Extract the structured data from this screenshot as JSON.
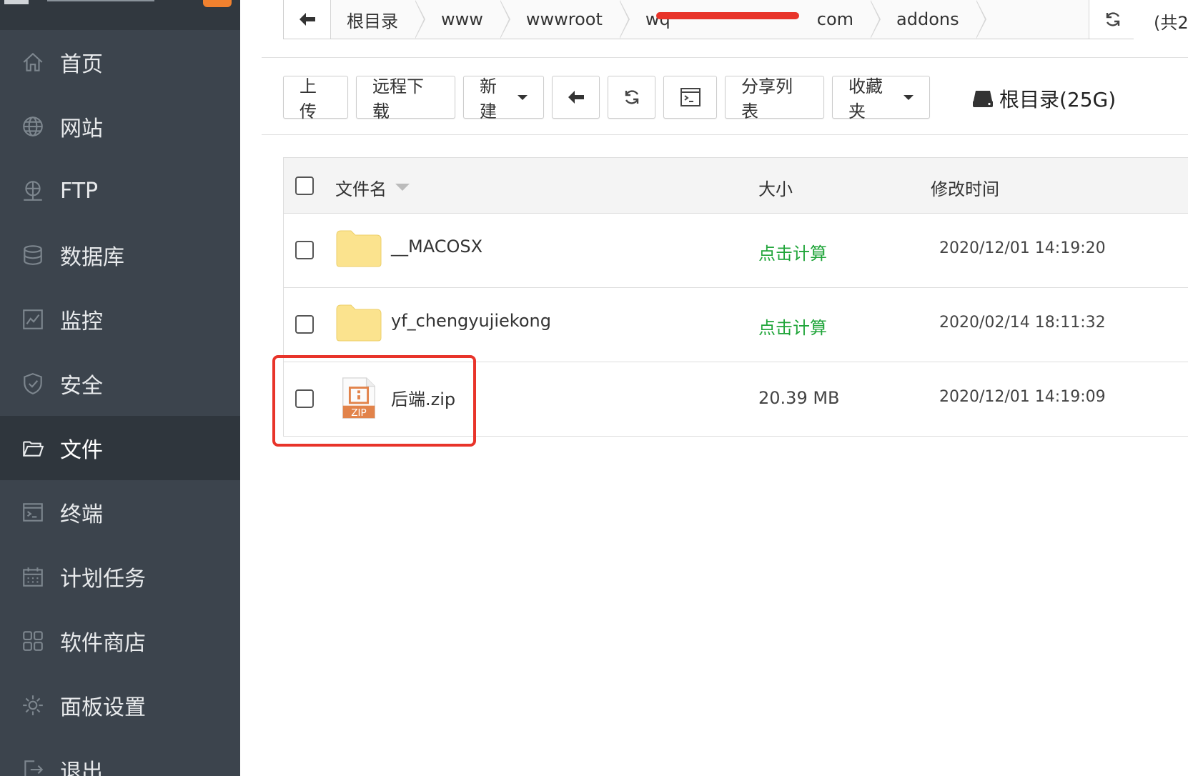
{
  "sidebar": {
    "items": [
      {
        "label": "首页",
        "icon": "home-icon"
      },
      {
        "label": "网站",
        "icon": "globe-icon"
      },
      {
        "label": "FTP",
        "icon": "ftp-icon"
      },
      {
        "label": "数据库",
        "icon": "database-icon"
      },
      {
        "label": "监控",
        "icon": "monitor-icon"
      },
      {
        "label": "安全",
        "icon": "shield-icon"
      },
      {
        "label": "文件",
        "icon": "folder-open-icon",
        "active": true
      },
      {
        "label": "终端",
        "icon": "terminal-icon"
      },
      {
        "label": "计划任务",
        "icon": "calendar-icon"
      },
      {
        "label": "软件商店",
        "icon": "apps-grid-icon"
      },
      {
        "label": "面板设置",
        "icon": "gear-icon"
      },
      {
        "label": "退出",
        "icon": "logout-icon"
      }
    ]
  },
  "breadcrumb": {
    "items": [
      "根目录",
      "www",
      "wwwroot",
      "wq",
      "com",
      "addons"
    ],
    "count_text": "(共2"
  },
  "toolbar": {
    "upload": "上传",
    "remote_download": "远程下载",
    "new": "新建",
    "share_list": "分享列表",
    "favorites": "收藏夹",
    "disk_label": "根目录(25G)"
  },
  "table": {
    "headers": {
      "name": "文件名",
      "size": "大小",
      "modified": "修改时间"
    },
    "rows": [
      {
        "name": "__MACOSX",
        "type": "folder",
        "size": "点击计算",
        "modified": "2020/12/01 14:19:20"
      },
      {
        "name": "yf_chengyujiekong",
        "type": "folder",
        "size": "点击计算",
        "modified": "2020/02/14 18:11:32"
      },
      {
        "name": "后端.zip",
        "type": "zip",
        "size": "20.39 MB",
        "modified": "2020/12/01 14:19:09",
        "zip_label": "ZIP"
      }
    ]
  },
  "colors": {
    "sidebar_bg": "#3c444d",
    "accent_green": "#20a53a",
    "highlight_red": "#e8342a",
    "folder_yellow": "#fbe38e",
    "zip_orange": "#e2834a"
  }
}
